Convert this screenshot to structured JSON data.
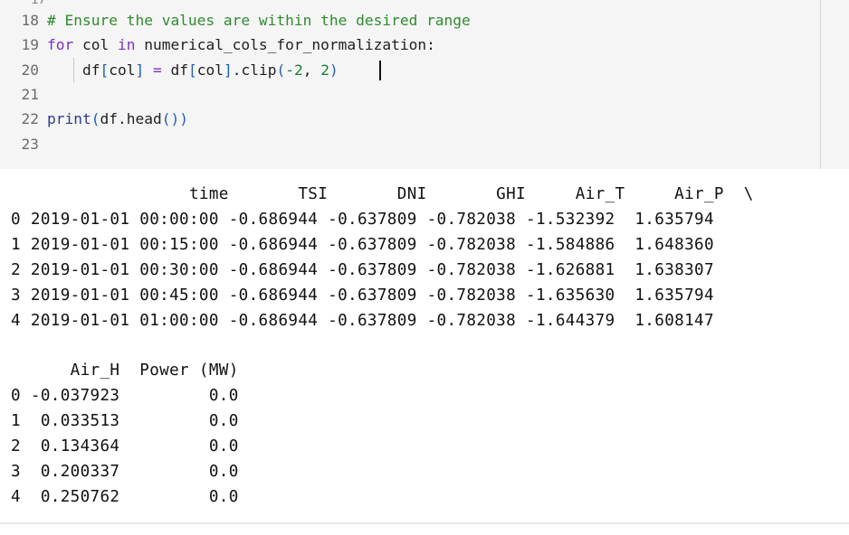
{
  "code": {
    "top_stub": "17",
    "lines": [
      {
        "num": "18",
        "parts": [
          {
            "t": "# Ensure the values are within the desired range",
            "c": "comment"
          }
        ]
      },
      {
        "num": "19",
        "parts": [
          {
            "t": "for",
            "c": "kw"
          },
          {
            "t": " col ",
            "c": "plain"
          },
          {
            "t": "in",
            "c": "kw"
          },
          {
            "t": " numerical_cols_for_normalization:",
            "c": "plain"
          }
        ]
      },
      {
        "num": "20",
        "parts": [
          {
            "t": "    df",
            "c": "plain"
          },
          {
            "t": "[",
            "c": "paren"
          },
          {
            "t": "col",
            "c": "plain"
          },
          {
            "t": "]",
            "c": "paren"
          },
          {
            "t": " ",
            "c": "plain"
          },
          {
            "t": "=",
            "c": "op"
          },
          {
            "t": " df",
            "c": "plain"
          },
          {
            "t": "[",
            "c": "paren"
          },
          {
            "t": "col",
            "c": "plain"
          },
          {
            "t": "]",
            "c": "paren"
          },
          {
            "t": ".clip",
            "c": "plain"
          },
          {
            "t": "(",
            "c": "paren"
          },
          {
            "t": "-2",
            "c": "num"
          },
          {
            "t": ", ",
            "c": "plain"
          },
          {
            "t": "2",
            "c": "num"
          },
          {
            "t": ")",
            "c": "paren"
          }
        ]
      },
      {
        "num": "21",
        "parts": []
      },
      {
        "num": "22",
        "parts": [
          {
            "t": "print",
            "c": "fn"
          },
          {
            "t": "(",
            "c": "paren"
          },
          {
            "t": "df.head",
            "c": "plain"
          },
          {
            "t": "()",
            "c": "paren"
          },
          {
            "t": ")",
            "c": "paren"
          }
        ]
      },
      {
        "num": "23",
        "parts": []
      }
    ]
  },
  "output": {
    "lines": [
      "                  time       TSI       DNI       GHI     Air_T     Air_P  \\",
      "0 2019-01-01 00:00:00 -0.686944 -0.637809 -0.782038 -1.532392  1.635794",
      "1 2019-01-01 00:15:00 -0.686944 -0.637809 -0.782038 -1.584886  1.648360",
      "2 2019-01-01 00:30:00 -0.686944 -0.637809 -0.782038 -1.626881  1.638307",
      "3 2019-01-01 00:45:00 -0.686944 -0.637809 -0.782038 -1.635630  1.635794",
      "4 2019-01-01 01:00:00 -0.686944 -0.637809 -0.782038 -1.644379  1.608147",
      "",
      "      Air_H  Power (MW)",
      "0 -0.037923         0.0",
      "1  0.033513         0.0",
      "2  0.134364         0.0",
      "3  0.200337         0.0",
      "4  0.250762         0.0"
    ]
  }
}
